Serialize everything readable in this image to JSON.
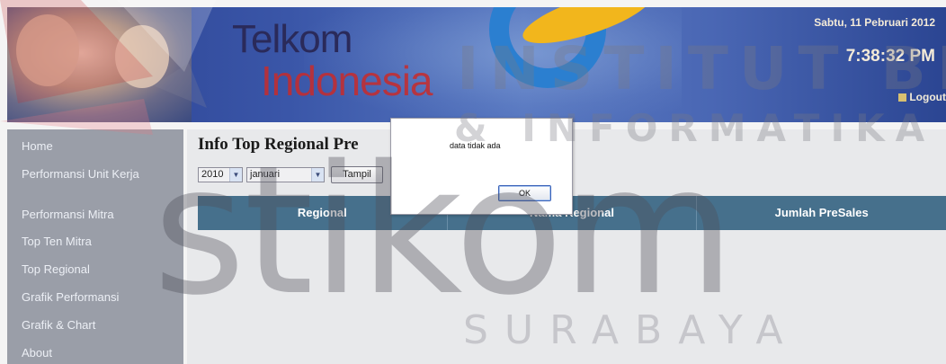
{
  "header": {
    "logo_line1": "Telkom",
    "logo_line2": "Indonesia",
    "date": "Sabtu, 11 Pebruari 2012",
    "time": "7:38:32 PM",
    "logout_label": "Logout"
  },
  "sidebar": {
    "items": [
      {
        "label": "Home"
      },
      {
        "label": "Performansi Unit Kerja"
      },
      {
        "label": "Performansi Mitra"
      },
      {
        "label": "Top Ten Mitra"
      },
      {
        "label": "Top Regional"
      },
      {
        "label": "Grafik Performansi"
      },
      {
        "label": "Grafik & Chart"
      },
      {
        "label": "About"
      }
    ]
  },
  "main": {
    "title": "Info Top Regional Pre",
    "year_select": "2010",
    "month_select": "januari",
    "tampil_button": "Tampil",
    "table": {
      "columns": [
        "Regional",
        "Nama Regional",
        "Jumlah PreSales"
      ]
    }
  },
  "dialog": {
    "message": "data tidak ada",
    "ok_label": "OK"
  },
  "watermark": {
    "line1": "INSTITUT BISNIS",
    "line2": "& INFORMATIKA",
    "line3": "stikom",
    "line4": "SURABAYA"
  }
}
